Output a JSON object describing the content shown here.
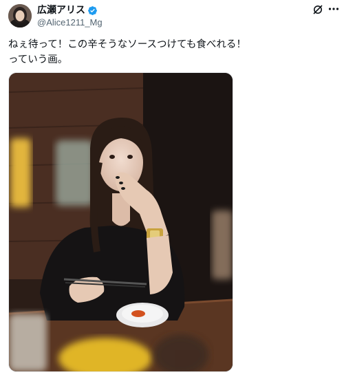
{
  "post": {
    "author_name": "広瀬アリス",
    "author_handle": "@Alice1211_Mg",
    "verified": true,
    "text_lines": [
      "ねぇ待って！この辛そうなソースつけても食べれる！",
      "っていう画。"
    ]
  },
  "icons": {
    "verified": "verified-badge-icon",
    "grok": "grok-icon",
    "more": "more-options-icon"
  },
  "colors": {
    "verified_blue": "#1d9bf0",
    "handle_gray": "#536471",
    "text": "#0f1419"
  }
}
